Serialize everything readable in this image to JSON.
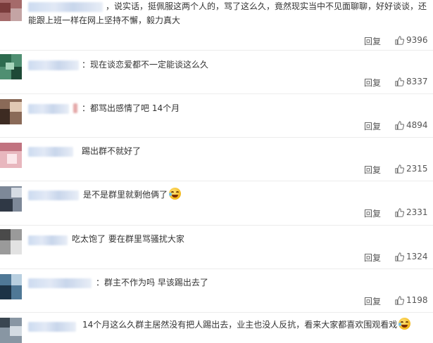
{
  "comments": [
    {
      "text": "，说实话，挺佩服这两个人的，骂了这么久，竟然现实当中不见面聊聊，好好谈谈，还能跟上班一样在网上坚持不懈，毅力真大",
      "reply": "回复",
      "likes": "9396",
      "avatar_colors": [
        "#7a3c3c",
        "#c4a4a4",
        "#5d2d2d",
        "#e2cfcf"
      ]
    },
    {
      "text": "：现在谈恋爱都不一定能谈这么久",
      "reply": "回复",
      "likes": "8337",
      "avatar_colors": [
        "#2d6b4f",
        "#7fbf9b",
        "#1e4a37",
        "#a8d6bd"
      ]
    },
    {
      "text": "：都骂出感情了吧 14个月",
      "reply": "回复",
      "likes": "4894",
      "avatar_colors": [
        "#6a5040",
        "#c3a088",
        "#3d2b22",
        "#e0c8b4"
      ]
    },
    {
      "text": "踢出群不就好了",
      "reply": "回复",
      "likes": "2315",
      "avatar_colors": [
        "#d89aa4",
        "#f3d3d8",
        "#c17380",
        "#fbe7ea"
      ]
    },
    {
      "text": "是不是群里就剩他俩了",
      "emoji": "laughing-tears",
      "reply": "回复",
      "likes": "2331",
      "avatar_colors": [
        "#4e5a6b",
        "#a6b1c0",
        "#2f3845",
        "#d5dbe3"
      ]
    },
    {
      "text": "吃太饱了 要在群里骂骚扰大家",
      "reply": "回复",
      "likes": "1324",
      "avatar_colors": [
        "#707070",
        "#bdbdbd",
        "#4a4a4a",
        "#e2e2e2"
      ]
    },
    {
      "text": "：群主不作为吗 早该踢出去了",
      "reply": "回复",
      "likes": "1198",
      "avatar_colors": [
        "#2f4f68",
        "#7fa3bf",
        "#1c3346",
        "#b8cfe0"
      ]
    },
    {
      "text": "14个月这么久群主居然没有把人踢出去，业主也没人反抗，看来大家都喜欢围观看戏",
      "emoji": "laughing-tears",
      "reply": "",
      "likes": "",
      "avatar_colors": [
        "#5a6a7a",
        "#a9b7c4",
        "#3a4651",
        "#d3dbe2"
      ]
    }
  ],
  "colors": {
    "username_blur": "#c8d8ef",
    "divider": "#ececec",
    "text": "#333333",
    "meta": "#555555"
  }
}
